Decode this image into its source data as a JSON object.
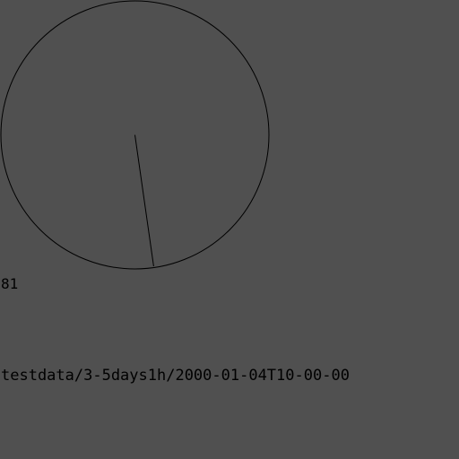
{
  "canvas": {
    "background": "#505050",
    "stroke_color": "#000000"
  },
  "dial": {
    "value_degrees": 81
  },
  "value_label": "81",
  "path_label": "testdata/3-5days1h/2000-01-04T10-00-00"
}
